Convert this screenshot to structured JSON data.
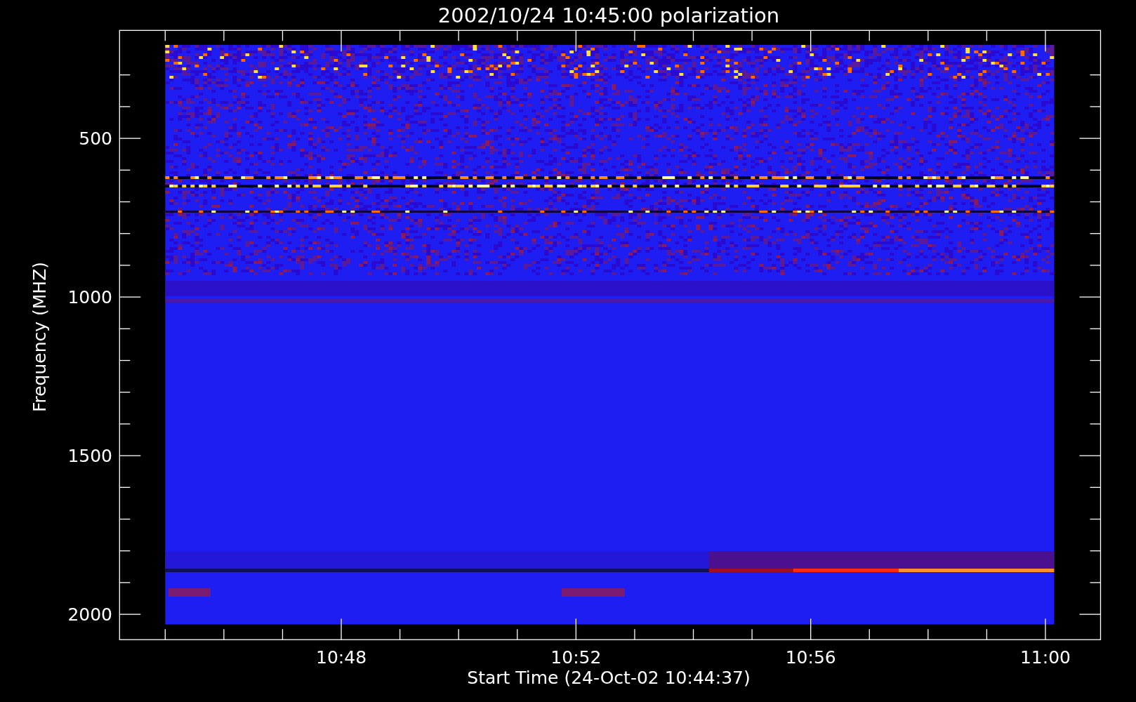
{
  "title": "2002/10/24 10:45:00 polarization",
  "y_axis": {
    "label": "Frequency (MHZ)",
    "tick_labels": [
      "500",
      "1000",
      "1500",
      "2000"
    ]
  },
  "x_axis": {
    "label": "Start Time (24-Oct-02 10:44:37)",
    "tick_labels": [
      "10:48",
      "10:52",
      "10:56",
      "11:00"
    ]
  }
}
